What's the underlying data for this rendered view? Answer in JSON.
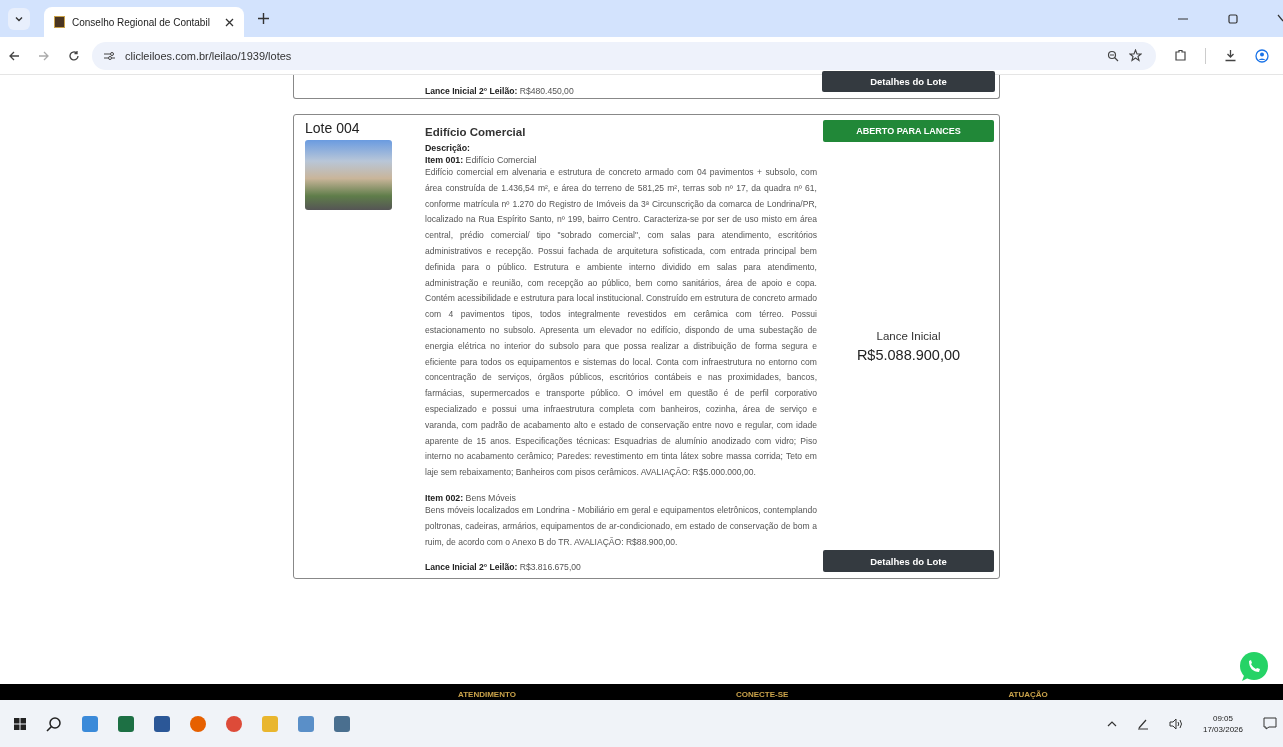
{
  "browser": {
    "tab": {
      "title": "Conselho Regional de Contabil",
      "selected": true
    },
    "url": "clicleiloes.com.br/leilao/1939/lotes"
  },
  "previous_lot": {
    "second_bid_label": "Lance Inicial 2° Leilão:",
    "second_bid": "R$480.450,00",
    "button": "Detalhes do Lote"
  },
  "lot": {
    "number": "Lote 004",
    "title": "Edifício Comercial",
    "status": "ABERTO PARA LANCES",
    "description_label": "Descrição:",
    "items": [
      {
        "heading": "**Item 001:** Edifício Comercial",
        "text": "Edifício comercial em alvenaria e estrutura de concreto armado com 04 pavimentos + subsolo, com área construída de 1.436,54 m², e área do terreno de 581,25 m², terras sob nº 17, da quadra nº 61, conforme matrícula nº 1.270 do Registro de Imóveis da 3ª Circunscrição da comarca de Londrina/PR, localizado na Rua Espírito Santo, nº 199, bairro Centro. Caracteriza-se por ser de uso misto em área central, prédio comercial/ tipo \"sobrado comercial\", com salas para atendimento, escritórios administrativos e recepção. Possui fachada de arquitetura sofisticada, com entrada principal bem definida para o público. Estrutura e ambiente interno dividido em salas para atendimento, administração e reunião, com recepção ao público, bem como sanitários, área de apoio e copa. Contém acessibilidade e estrutura para local institucional. Construído em estrutura de concreto armado com 4 pavimentos tipos, todos integralmente revestidos em cerâmica com térreo. Possui estacionamento no subsolo. Apresenta um elevador no edifício, dispondo de uma subestação de energia elétrica no interior do subsolo para que possa realizar a distribuição de forma segura e eficiente para todos os equipamentos e sistemas do local. Conta com infraestrutura no entorno com concentração de serviços, órgãos públicos, escritórios contábeis e nas proximidades, bancos, farmácias, supermercados e transporte público. O imóvel em questão é de perfil corporativo especializado e possui uma infraestrutura completa com banheiros, cozinha, área de serviço e varanda, com padrão de acabamento alto e estado de conservação entre novo e regular, com idade aparente de 15 anos. Especificações técnicas: Esquadrias de alumínio anodizado com vidro; Piso interno no acabamento cerâmico; Paredes: revestimento em tinta látex sobre massa corrida; Teto em laje sem rebaixamento; Banheiros com pisos cerâmicos. AVALIAÇÃO: R$5.000.000,00."
      },
      {
        "heading": "**Item 002:** Bens Móveis",
        "text": "Bens móveis localizados em Londrina - Mobiliário em geral e equipamentos eletrônicos, contemplando poltronas, cadeiras, armários, equipamentos de ar-condicionado, em estado de conservação de bom a ruim, de acordo com o Anexo B do TR. AVALIAÇÃO: R$88.900,00."
      }
    ],
    "initial_bid_label": "Lance Inicial",
    "initial_bid": "R$5.088.900,00",
    "second_bid_label": "Lance Inicial 2° Leilão:",
    "second_bid": "R$3.816.675,00",
    "button": "Detalhes do Lote"
  },
  "footer": {
    "headings": [
      "ATENDIMENTO",
      "CONECTE-SE",
      "ATUAÇÃO"
    ]
  },
  "taskbar": {
    "time": "09:05",
    "date": "17/03/2026"
  }
}
